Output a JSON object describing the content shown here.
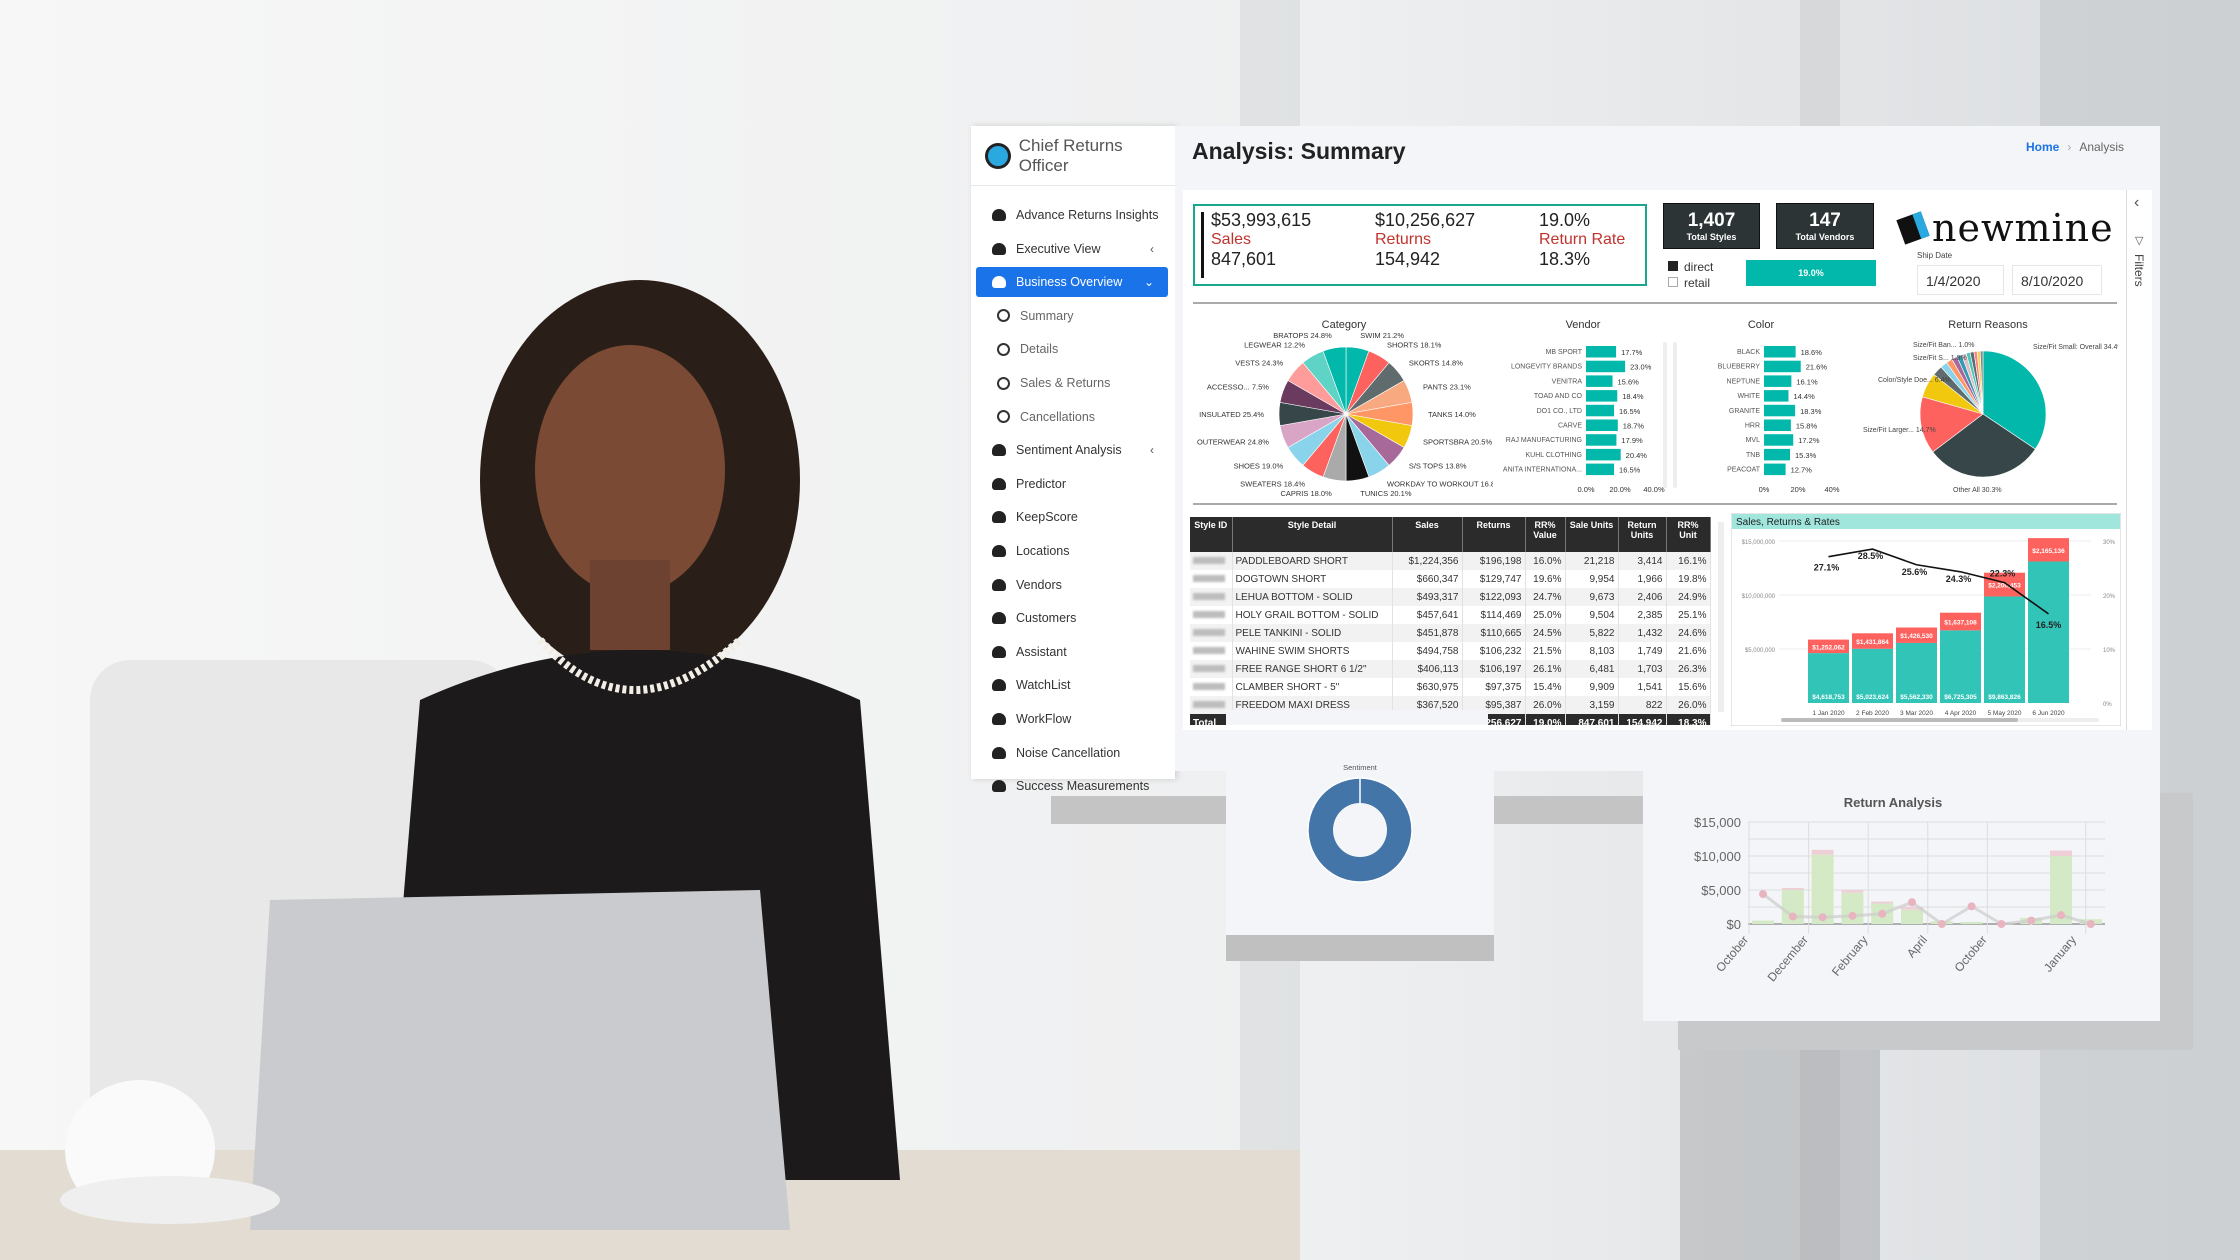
{
  "app": {
    "name": "Chief Returns Officer"
  },
  "header": {
    "title": "Analysis: Summary",
    "breadcrumb": [
      "Home",
      "Analysis"
    ]
  },
  "sidebar": {
    "items": [
      {
        "label": "Advance Returns Insights",
        "icon": "dashboard-icon"
      },
      {
        "label": "Executive View",
        "icon": "dashboard-icon",
        "chevron": "‹"
      },
      {
        "label": "Business Overview",
        "icon": "dashboard-icon",
        "chevron": "⌄",
        "active": true
      },
      {
        "label": "Summary",
        "icon": "circle-icon",
        "sub": true
      },
      {
        "label": "Details",
        "icon": "circle-icon",
        "sub": true
      },
      {
        "label": "Sales & Returns",
        "icon": "circle-icon",
        "sub": true
      },
      {
        "label": "Cancellations",
        "icon": "circle-icon",
        "sub": true
      },
      {
        "label": "Sentiment Analysis",
        "icon": "dashboard-icon",
        "chevron": "‹"
      },
      {
        "label": "Predictor",
        "icon": "dashboard-icon"
      },
      {
        "label": "KeepScore",
        "icon": "dashboard-icon"
      },
      {
        "label": "Locations",
        "icon": "dashboard-icon"
      },
      {
        "label": "Vendors",
        "icon": "dashboard-icon"
      },
      {
        "label": "Customers",
        "icon": "dashboard-icon"
      },
      {
        "label": "Assistant",
        "icon": "ambulance-icon"
      },
      {
        "label": "WatchList",
        "icon": "eye-slash-icon"
      },
      {
        "label": "WorkFlow",
        "icon": "cubes-icon"
      },
      {
        "label": "Noise Cancellation",
        "icon": "deaf-icon"
      },
      {
        "label": "Success Measurements",
        "icon": "money-bill-icon"
      }
    ]
  },
  "kpis": {
    "sales_value": "$53,993,615",
    "sales_label": "Sales",
    "sales_units": "847,601",
    "returns_value": "$10,256,627",
    "returns_label": "Returns",
    "returns_units": "154,942",
    "rate_value": "19.0%",
    "rate_label": "Return Rate",
    "rate_units": "18.3%"
  },
  "cards": {
    "styles": "1,407",
    "styles_label": "Total Styles",
    "vendors": "147",
    "vendors_label": "Total Vendors"
  },
  "channel": {
    "options": [
      "direct",
      "retail"
    ],
    "selected": "direct",
    "rate": "19.0%",
    "rate_fraction": 0.19
  },
  "brand_logo": "newmine",
  "ship_date": {
    "label": "Ship Date",
    "from": "1/4/2020",
    "to": "8/10/2020"
  },
  "filters_label": "Filters",
  "colors": {
    "teal": "#01b8aa",
    "red": "#fd625e",
    "dark": "#374649",
    "accent_blue": "#1a73e8",
    "sentiment": "#4375a8"
  },
  "chart_data": [
    {
      "type": "pie",
      "title": "Category",
      "slices": [
        {
          "label": "SWIM",
          "value": "21.2%"
        },
        {
          "label": "SHORTS",
          "value": "18.1%"
        },
        {
          "label": "SKORTS",
          "value": "14.8%"
        },
        {
          "label": "PANTS",
          "value": "23.1%"
        },
        {
          "label": "TANKS",
          "value": "14.0%"
        },
        {
          "label": "SPORTSBRA",
          "value": "20.5%"
        },
        {
          "label": "S/S TOPS",
          "value": "13.8%"
        },
        {
          "label": "WORKDAY TO WORKOUT",
          "value": "16.8%"
        },
        {
          "label": "TUNICS",
          "value": "20.1%"
        },
        {
          "label": "CAPRIS",
          "value": "18.0%"
        },
        {
          "label": "SWEATERS",
          "value": "18.4%"
        },
        {
          "label": "SHOES",
          "value": "19.0%"
        },
        {
          "label": "OUTERWEAR",
          "value": "24.8%"
        },
        {
          "label": "INSULATED",
          "value": "25.4%"
        },
        {
          "label": "ACCESSO...",
          "value": "7.5%"
        },
        {
          "label": "VESTS",
          "value": "24.3%"
        },
        {
          "label": "LEGWEAR",
          "value": "12.2%"
        },
        {
          "label": "BRATOPS",
          "value": "24.8%"
        }
      ]
    },
    {
      "type": "bar",
      "title": "Vendor",
      "categories": [
        "MB SPORT",
        "LONGEVITY BRANDS",
        "VENITRA",
        "TOAD AND CO",
        "DO1 CO., LTD",
        "CARVE",
        "RAJ MANUFACTURING",
        "KUHL CLOTHING",
        "ANITA INTERNATIONA..."
      ],
      "values": [
        17.7,
        23.0,
        15.6,
        18.4,
        16.5,
        18.7,
        17.9,
        20.4,
        16.5
      ],
      "xlim": [
        0,
        40
      ],
      "ticks": [
        "0.0%",
        "20.0%",
        "40.0%"
      ]
    },
    {
      "type": "bar",
      "title": "Color",
      "categories": [
        "BLACK",
        "BLUEBERRY",
        "NEPTUNE",
        "WHITE",
        "GRANITE",
        "HRR",
        "MVL",
        "TNB",
        "PEACOAT"
      ],
      "values": [
        18.6,
        21.6,
        16.1,
        14.4,
        18.3,
        15.8,
        17.2,
        15.3,
        12.7
      ],
      "xlim": [
        0,
        40
      ],
      "ticks": [
        "0%",
        "20%",
        "40%"
      ]
    },
    {
      "type": "pie",
      "title": "Return Reasons",
      "slices": [
        {
          "label": "Size/Fit Small: Overall",
          "value": 34.4
        },
        {
          "label": "Other All",
          "value": 30.3
        },
        {
          "label": "Size/Fit Larger...",
          "value": 14.7
        },
        {
          "label": "Color/Style Doe...",
          "value": 6.4
        },
        {
          "label": "",
          "value": 2.6
        },
        {
          "label": "Size/Fit S...",
          "value": 1.8
        },
        {
          "label": "",
          "value": 1.6
        },
        {
          "label": "",
          "value": 1.4
        },
        {
          "label": "",
          "value": 1.3
        },
        {
          "label": "",
          "value": 1.2
        },
        {
          "label": "Size/Fit Ban...",
          "value": 1.0
        },
        {
          "label": "",
          "value": 1.0
        },
        {
          "label": "",
          "value": 0.8
        },
        {
          "label": "",
          "value": 0.8
        },
        {
          "label": "",
          "value": 0.7
        }
      ]
    },
    {
      "type": "bar",
      "title": "Sales, Returns & Rates",
      "stacked": true,
      "categories": [
        "1 Jan 2020",
        "2 Feb 2020",
        "3 Mar 2020",
        "4 Apr 2020",
        "5 May 2020",
        "6 Jun 2020"
      ],
      "series": [
        {
          "name": "Sales",
          "values": [
            4618753,
            5023624,
            5562330,
            6725305,
            9863826,
            13100000
          ],
          "labels": [
            "$4,618,753",
            "$5,023,624",
            "$5,562,330",
            "$6,725,305",
            "$9,863,826",
            ""
          ]
        },
        {
          "name": "Returns",
          "values": [
            1252062,
            1431864,
            1426530,
            1637108,
            2200453,
            2165136
          ],
          "labels": [
            "$1,252,062",
            "$1,431,864",
            "$1,426,530",
            "$1,637,108",
            "$2,200,453",
            "$2,165,136"
          ]
        },
        {
          "name": "Rate",
          "type": "line",
          "values": [
            27.1,
            28.5,
            25.6,
            24.3,
            22.3,
            16.5
          ],
          "labels": [
            "27.1%",
            "28.5%",
            "25.6%",
            "24.3%",
            "22.3%",
            "16.5%"
          ]
        }
      ],
      "ylim": [
        0,
        15000000
      ],
      "yticks": [
        "$5,000,000",
        "$10,000,000",
        "$15,000,000"
      ],
      "y2lim": [
        0,
        30
      ],
      "y2ticks": [
        "0%",
        "10%",
        "20%",
        "30%"
      ]
    },
    {
      "type": "table",
      "columns": [
        "Style ID",
        "Style Detail",
        "Sales",
        "Returns",
        "RR% Value",
        "Sale Units",
        "Return Units",
        "RR% Unit"
      ],
      "rows": [
        [
          "",
          "PADDLEBOARD SHORT",
          "$1,224,356",
          "$196,198",
          "16.0%",
          "21,218",
          "3,414",
          "16.1%"
        ],
        [
          "",
          "DOGTOWN SHORT",
          "$660,347",
          "$129,747",
          "19.6%",
          "9,954",
          "1,966",
          "19.8%"
        ],
        [
          "",
          "LEHUA BOTTOM - SOLID",
          "$493,317",
          "$122,093",
          "24.7%",
          "9,673",
          "2,406",
          "24.9%"
        ],
        [
          "",
          "HOLY GRAIL BOTTOM - SOLID",
          "$457,641",
          "$114,469",
          "25.0%",
          "9,504",
          "2,385",
          "25.1%"
        ],
        [
          "",
          "PELE TANKINI - SOLID",
          "$451,878",
          "$110,665",
          "24.5%",
          "5,822",
          "1,432",
          "24.6%"
        ],
        [
          "",
          "WAHINE SWIM SHORTS",
          "$494,758",
          "$106,232",
          "21.5%",
          "8,103",
          "1,749",
          "21.6%"
        ],
        [
          "",
          "FREE RANGE SHORT 6 1/2\"",
          "$406,113",
          "$106,197",
          "26.1%",
          "6,481",
          "1,703",
          "26.3%"
        ],
        [
          "",
          "CLAMBER SHORT - 5\"",
          "$630,975",
          "$97,375",
          "15.4%",
          "9,909",
          "1,541",
          "15.6%"
        ],
        [
          "",
          "FREEDOM MAXI DRESS",
          "$367,520",
          "$95,387",
          "26.0%",
          "3,159",
          "822",
          "26.0%"
        ]
      ],
      "total": [
        "Total",
        "",
        "",
        "$10,256,627",
        "19.0%",
        "847,601",
        "154,942",
        "18.3%"
      ]
    },
    {
      "type": "pie",
      "title": "Sentiment",
      "donut": true,
      "slices": [
        {
          "label": "",
          "value": 100
        }
      ]
    },
    {
      "type": "bar",
      "title": "Return Analysis",
      "xticks": [
        "October",
        "December",
        "February",
        "April",
        "October",
        "January"
      ],
      "series": [
        {
          "values": [
            500,
            5000,
            10200,
            4600,
            3000,
            2100,
            400,
            300,
            0,
            900,
            10000,
            700
          ]
        },
        {
          "values": [
            0,
            300,
            700,
            400,
            300,
            400,
            0,
            0,
            0,
            0,
            800,
            0
          ]
        },
        {
          "type": "line",
          "values": [
            4400,
            1100,
            1000,
            1200,
            1500,
            3200,
            0,
            2600,
            0,
            500,
            1300,
            0
          ]
        }
      ],
      "ylim": [
        0,
        15000
      ],
      "yticks": [
        "$0",
        "$5,000",
        "$10,000",
        "$15,000"
      ]
    }
  ]
}
